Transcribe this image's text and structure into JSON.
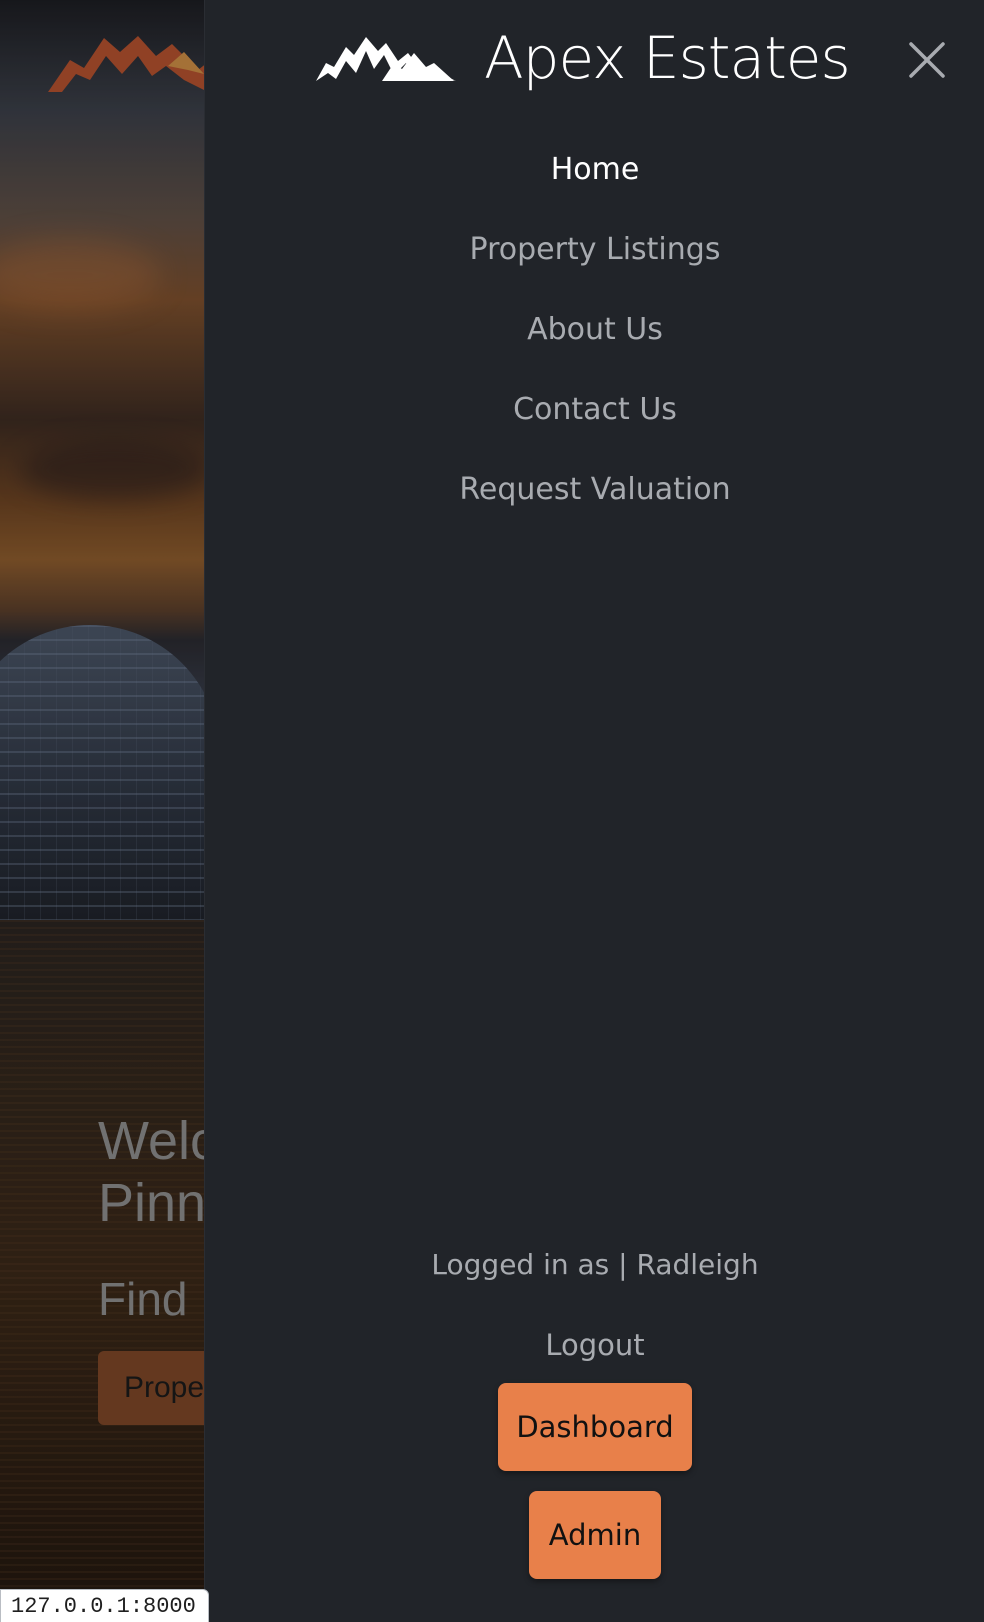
{
  "status_bar": {
    "url": "127.0.0.1:8000"
  },
  "background": {
    "hero_title_line1": "Welc",
    "hero_title_line2": "Pinn",
    "hero_subtitle": "Find",
    "hero_button": "Prope"
  },
  "menu": {
    "brand": {
      "name": "Apex Estates",
      "logo_icon": "mountain-logo-icon"
    },
    "close_icon": "close-icon",
    "nav_items": [
      {
        "label": "Home",
        "active": true
      },
      {
        "label": "Property Listings",
        "active": false
      },
      {
        "label": "About Us",
        "active": false
      },
      {
        "label": "Contact Us",
        "active": false
      },
      {
        "label": "Request Valuation",
        "active": false
      }
    ],
    "logged_in_text": "Logged in as | Radleigh",
    "logout_label": "Logout",
    "dashboard_label": "Dashboard",
    "admin_label": "Admin"
  },
  "colors": {
    "menu_background": "#212429",
    "accent": "#e8804a",
    "nav_text": "#a8abb0",
    "active_nav": "#ffffff"
  }
}
